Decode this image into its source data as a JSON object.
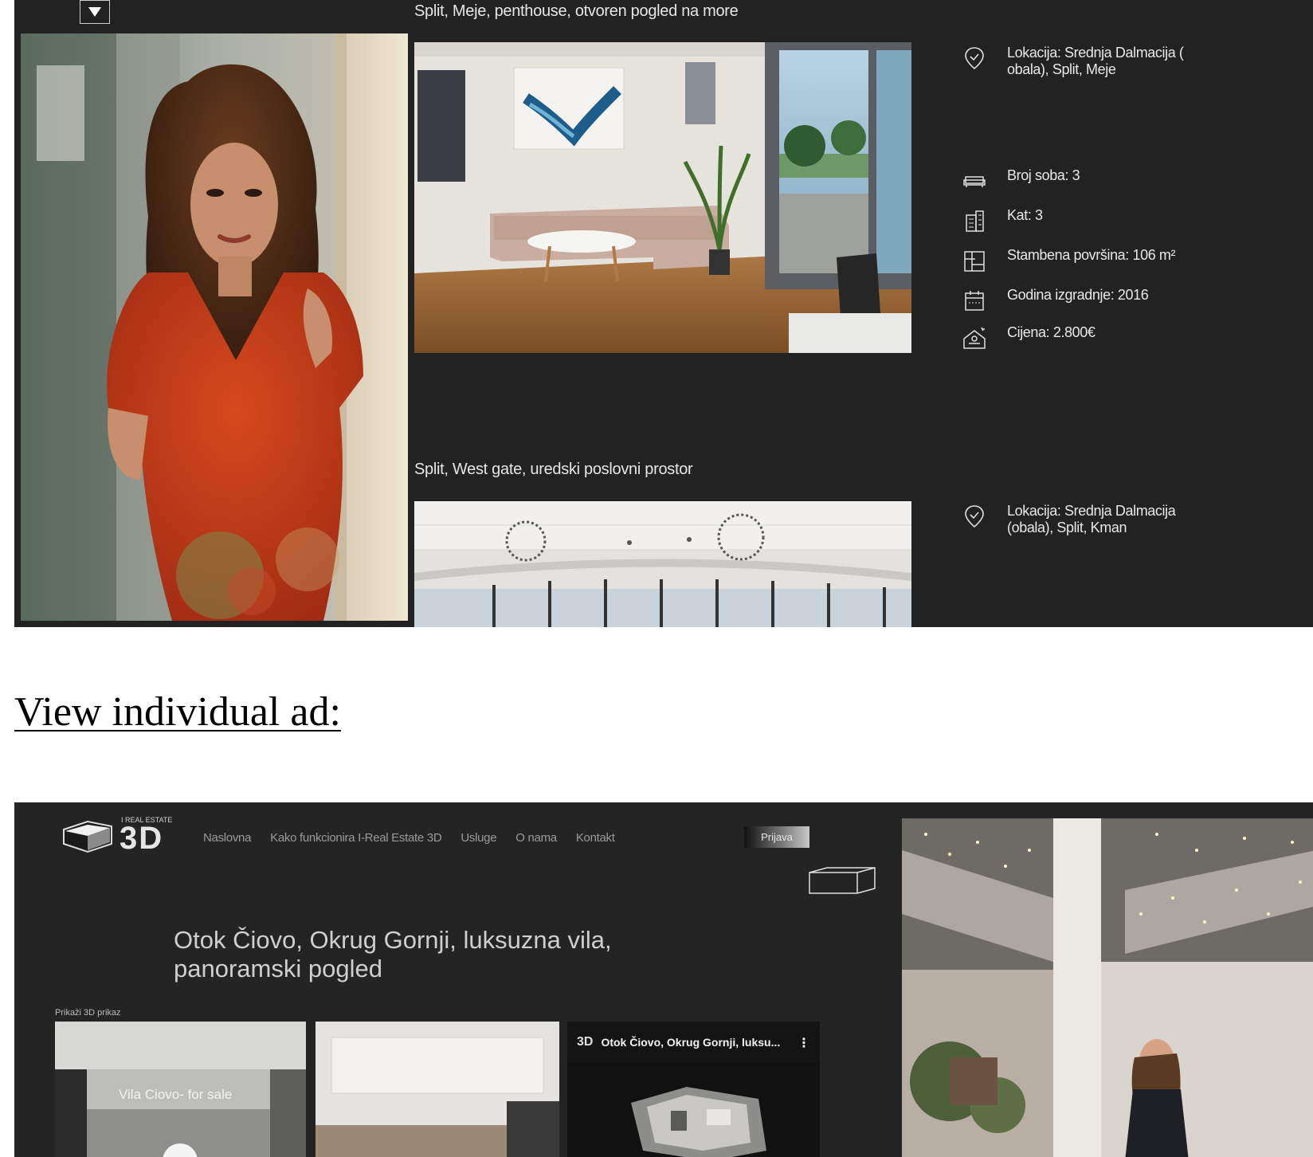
{
  "top_listing": {
    "listing1": {
      "title": "Split, Meje, penthouse, otvoren pogled na more",
      "location": "Lokacija: Srednja Dalmacija ( obala), Split, Meje",
      "rooms": "Broj soba: 3",
      "floor": "Kat: 3",
      "living_area": "Stambena površina: 106 m²",
      "build_year": "Godina izgradnje: 2016",
      "price": "Cijena:  2.800€"
    },
    "listing2": {
      "title": "Split, West gate, uredski poslovni prostor",
      "location": "Lokacija: Srednja Dalmacija (obala), Split, Kman"
    }
  },
  "section_heading": "View individual ad:",
  "ad_page": {
    "logo_small": "I REAL ESTATE",
    "logo_big": "3D",
    "nav": [
      "Naslovna",
      "Kako funkcionira I-Real Estate 3D",
      "Usluge",
      "O nama",
      "Kontakt"
    ],
    "login_label": "Prijava",
    "property_title": "Otok Čiovo, Okrug Gornji, luksuzna vila, panoramski pogled",
    "show_3d_label": "Prikaži 3D prikaz",
    "thumb1_caption": "Vila Ciovo- for sale",
    "video_title": "Otok Čiovo, Okrug Gornji, luksu...",
    "video_menu": "⋮"
  },
  "colors": {
    "panel_bg": "#222222",
    "text_light": "#e6e6e6",
    "dress_red": "#c2381a"
  },
  "icons": [
    "dropdown-arrow-icon",
    "location-pin-icon",
    "sofa-icon",
    "building-icon",
    "floor-plan-icon",
    "calendar-icon",
    "price-house-icon",
    "box3d-icon",
    "logo-3d-icon"
  ]
}
